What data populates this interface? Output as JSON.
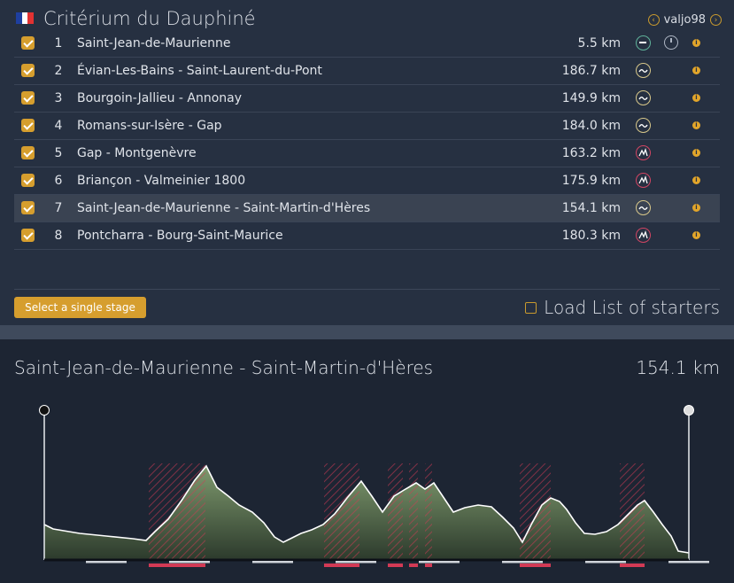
{
  "race": {
    "title": "Critérium du Dauphiné",
    "flag_colors": [
      "#1e3fa0",
      "#ffffff",
      "#e23232"
    ],
    "user": "valjo98"
  },
  "stages": [
    {
      "num": "1",
      "name": "Saint-Jean-de-Maurienne",
      "distance": "5.5 km",
      "type": "flat",
      "time_trial": true,
      "checked": true
    },
    {
      "num": "2",
      "name": "Évian-Les-Bains - Saint-Laurent-du-Pont",
      "distance": "186.7 km",
      "type": "hilly",
      "checked": true
    },
    {
      "num": "3",
      "name": "Bourgoin-Jallieu - Annonay",
      "distance": "149.9 km",
      "type": "hilly",
      "checked": true
    },
    {
      "num": "4",
      "name": "Romans-sur-Isère - Gap",
      "distance": "184.0 km",
      "type": "hilly",
      "checked": true
    },
    {
      "num": "5",
      "name": "Gap - Montgenèvre",
      "distance": "163.2 km",
      "type": "mountain",
      "checked": true
    },
    {
      "num": "6",
      "name": "Briançon - Valmeinier 1800",
      "distance": "175.9 km",
      "type": "mountain",
      "checked": true
    },
    {
      "num": "7",
      "name": "Saint-Jean-de-Maurienne - Saint-Martin-d'Hères",
      "distance": "154.1 km",
      "type": "hilly",
      "checked": true,
      "selected": true
    },
    {
      "num": "8",
      "name": "Pontcharra - Bourg-Saint-Maurice",
      "distance": "180.3 km",
      "type": "mountain",
      "checked": true
    }
  ],
  "controls": {
    "select_single_stage": "Select a single stage",
    "load_list_of_starters": "Load List of starters"
  },
  "profile": {
    "stage_name": "Saint-Jean-de-Maurienne - Saint-Martin-d'Hères",
    "distance": "154.1 km",
    "colors": {
      "fill": "#5c7a4e",
      "climb": "#d23a55",
      "outline": "#ffffff"
    }
  }
}
